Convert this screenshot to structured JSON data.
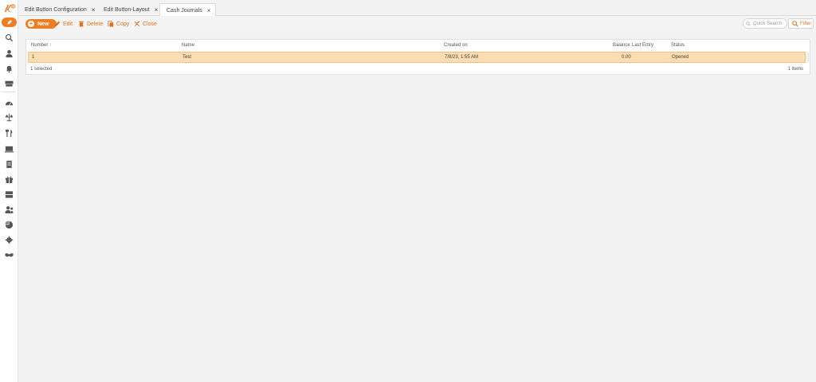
{
  "tabs": [
    {
      "label": "Edit Button Configuration"
    },
    {
      "label": "Edit Button-Layout"
    },
    {
      "label": "Cash Journals",
      "active": true
    }
  ],
  "tab_close_glyph": "×",
  "toolbar": {
    "new_label": "New",
    "edit_label": "Edit",
    "delete_label": "Delete",
    "copy_label": "Copy",
    "close_label": "Close",
    "search_placeholder": "Quick Search",
    "filter_label": "Filter"
  },
  "grid": {
    "columns": {
      "number": "Number",
      "sort_indicator": "↑",
      "name": "Name",
      "created_on": "Created on",
      "balance": "Balance",
      "last_entry": "Last Entry",
      "status": "Status"
    },
    "rows": [
      {
        "number": "1",
        "name": "Test",
        "created_on": "7/8/23, 1:55 AM",
        "balance": "0.00",
        "last_entry": "",
        "status": "Opened",
        "selected": true
      }
    ],
    "footer": {
      "selected": "1 selected",
      "count": "1 items"
    }
  },
  "colors": {
    "accent": "#ef7d22",
    "selected_row": "#fcdcb0"
  },
  "sidebar_icons": [
    "pin-icon",
    "search-icon",
    "person-icon",
    "bell-icon",
    "cash-register-icon",
    "dashboard-icon",
    "scale-icon",
    "fork-knife-icon",
    "monitor-icon",
    "document-icon",
    "gift-icon",
    "server-icon",
    "users-icon",
    "pie-chart-icon",
    "gear-icon",
    "handshake-icon"
  ]
}
